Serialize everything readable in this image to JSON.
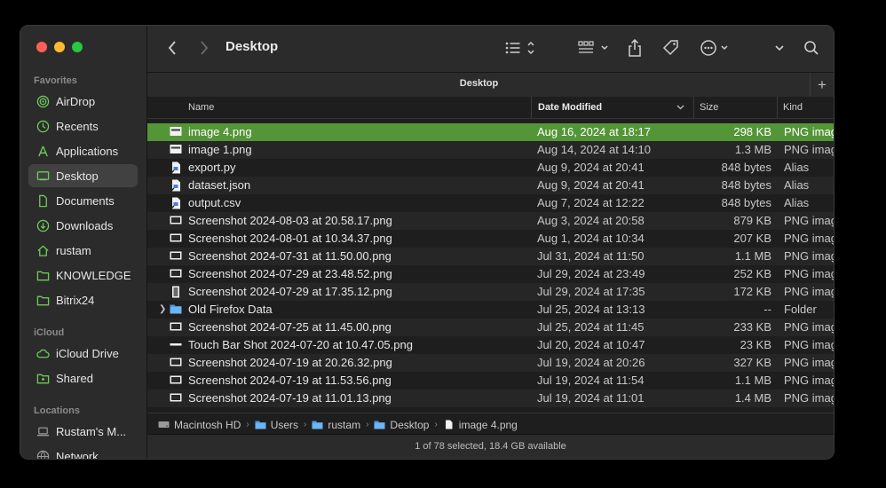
{
  "window": {
    "title": "Desktop",
    "tab_title": "Desktop"
  },
  "sidebar": {
    "sections": {
      "favorites": "Favorites",
      "icloud": "iCloud",
      "locations": "Locations"
    },
    "items": [
      {
        "label": "AirDrop",
        "icon": "airdrop-icon"
      },
      {
        "label": "Recents",
        "icon": "clock-icon"
      },
      {
        "label": "Applications",
        "icon": "applications-icon"
      },
      {
        "label": "Desktop",
        "icon": "desktop-icon",
        "active": true
      },
      {
        "label": "Documents",
        "icon": "document-icon"
      },
      {
        "label": "Downloads",
        "icon": "download-icon"
      },
      {
        "label": "rustam",
        "icon": "home-icon"
      },
      {
        "label": "KNOWLEDGE",
        "icon": "folder-icon"
      },
      {
        "label": "Bitrix24",
        "icon": "folder-icon"
      },
      {
        "label": "iCloud Drive",
        "icon": "cloud-icon"
      },
      {
        "label": "Shared",
        "icon": "shared-folder-icon"
      },
      {
        "label": "Rustam's M...",
        "icon": "laptop-icon"
      },
      {
        "label": "Network",
        "icon": "network-icon"
      }
    ]
  },
  "columns": {
    "name": "Name",
    "date": "Date Modified",
    "size": "Size",
    "kind": "Kind"
  },
  "files": [
    {
      "name": "image 4.png",
      "date": "Aug 16, 2024 at 18:17",
      "size": "298 KB",
      "kind": "PNG image",
      "icon": "image-file-icon",
      "selected": true
    },
    {
      "name": "image 1.png",
      "date": "Aug 14, 2024 at 14:10",
      "size": "1.3 MB",
      "kind": "PNG image",
      "icon": "image-file-icon"
    },
    {
      "name": "export.py",
      "date": "Aug 9, 2024 at 20:41",
      "size": "848 bytes",
      "kind": "Alias",
      "icon": "alias-file-icon"
    },
    {
      "name": "dataset.json",
      "date": "Aug 9, 2024 at 20:41",
      "size": "848 bytes",
      "kind": "Alias",
      "icon": "alias-file-icon"
    },
    {
      "name": "output.csv",
      "date": "Aug 7, 2024 at 12:22",
      "size": "848 bytes",
      "kind": "Alias",
      "icon": "alias-file-icon"
    },
    {
      "name": "Screenshot 2024-08-03 at 20.58.17.png",
      "date": "Aug 3, 2024 at 20:58",
      "size": "879 KB",
      "kind": "PNG image",
      "icon": "screenshot-file-icon"
    },
    {
      "name": "Screenshot 2024-08-01 at 10.34.37.png",
      "date": "Aug 1, 2024 at 10:34",
      "size": "207 KB",
      "kind": "PNG image",
      "icon": "screenshot-file-icon"
    },
    {
      "name": "Screenshot 2024-07-31 at 11.50.00.png",
      "date": "Jul 31, 2024 at 11:50",
      "size": "1.1 MB",
      "kind": "PNG image",
      "icon": "screenshot-file-icon"
    },
    {
      "name": "Screenshot 2024-07-29 at 23.48.52.png",
      "date": "Jul 29, 2024 at 23:49",
      "size": "252 KB",
      "kind": "PNG image",
      "icon": "screenshot-file-icon"
    },
    {
      "name": "Screenshot 2024-07-29 at 17.35.12.png",
      "date": "Jul 29, 2024 at 17:35",
      "size": "172 KB",
      "kind": "PNG image",
      "icon": "screenshot-tall-file-icon"
    },
    {
      "name": "Old Firefox Data",
      "date": "Jul 25, 2024 at 13:13",
      "size": "--",
      "kind": "Folder",
      "icon": "folder-icon",
      "folder": true
    },
    {
      "name": "Screenshot 2024-07-25 at 11.45.00.png",
      "date": "Jul 25, 2024 at 11:45",
      "size": "233 KB",
      "kind": "PNG image",
      "icon": "screenshot-file-icon"
    },
    {
      "name": "Touch Bar Shot 2024-07-20 at 10.47.05.png",
      "date": "Jul 20, 2024 at 10:47",
      "size": "23 KB",
      "kind": "PNG image",
      "icon": "touchbar-file-icon"
    },
    {
      "name": "Screenshot 2024-07-19 at 20.26.32.png",
      "date": "Jul 19, 2024 at 20:26",
      "size": "327 KB",
      "kind": "PNG image",
      "icon": "screenshot-file-icon"
    },
    {
      "name": "Screenshot 2024-07-19 at 11.53.56.png",
      "date": "Jul 19, 2024 at 11:54",
      "size": "1.1 MB",
      "kind": "PNG image",
      "icon": "screenshot-file-icon"
    },
    {
      "name": "Screenshot 2024-07-19 at 11.01.13.png",
      "date": "Jul 19, 2024 at 11:01",
      "size": "1.4 MB",
      "kind": "PNG image",
      "icon": "screenshot-file-icon"
    }
  ],
  "pathbar": [
    {
      "label": "Macintosh HD",
      "icon": "disk-icon"
    },
    {
      "label": "Users",
      "icon": "folder-icon"
    },
    {
      "label": "rustam",
      "icon": "folder-icon"
    },
    {
      "label": "Desktop",
      "icon": "folder-icon"
    },
    {
      "label": "image 4.png",
      "icon": "file-icon"
    }
  ],
  "status": "1 of 78 selected, 18.4 GB available",
  "colors": {
    "accent": "#549538",
    "folder_blue": "#4a9be8",
    "sidebar_green": "#6ec95a"
  }
}
